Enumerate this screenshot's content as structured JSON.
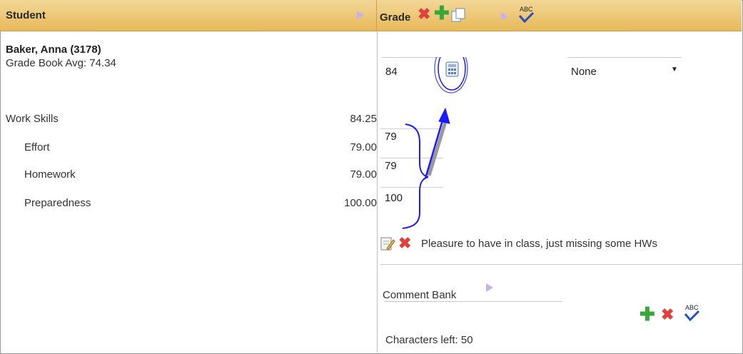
{
  "header": {
    "student_title": "Student",
    "grade_title": "Grade"
  },
  "student": {
    "name": "Baker, Anna (3178)",
    "avg": "Grade Book Avg: 74.34"
  },
  "skills": [
    {
      "label": "Work Skills",
      "score": "84.25"
    },
    {
      "label": "Effort",
      "score": "79.00",
      "grade": "79"
    },
    {
      "label": "Homework",
      "score": "79.00",
      "grade": "79"
    },
    {
      "label": "Preparedness",
      "score": "100.00",
      "grade": "100"
    }
  ],
  "grade": {
    "value": "84",
    "dropdown": "None"
  },
  "comment": {
    "text": "Pleasure to have in class, just missing some HWs",
    "bank_label": "Comment Bank",
    "chars_left": "Characters left:",
    "chars_count": "50"
  },
  "colors": {
    "header_gradient_top": "#f3d797",
    "header_gradient_bottom": "#e7b95a",
    "annotation": "#1a1aff"
  },
  "icons": {
    "calculator": "calculator-icon",
    "delete": "delete-icon",
    "add": "add-icon",
    "spellcheck": "spellcheck-icon"
  }
}
